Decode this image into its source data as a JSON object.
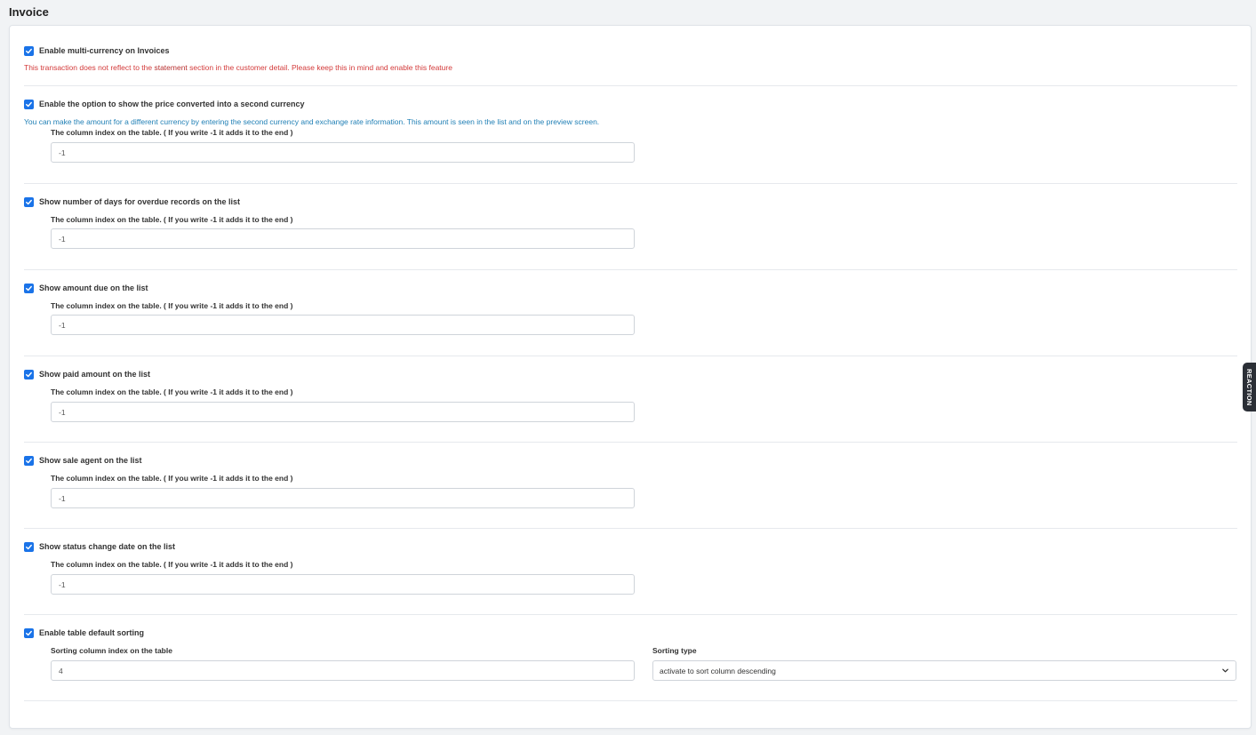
{
  "page": {
    "title": "Invoice"
  },
  "multi_currency": {
    "label": "Enable multi-currency on Invoices",
    "checked": true,
    "warning_pre": "This transaction does not reflect to the ",
    "warning_bold": "statement",
    "warning_post": " section in the customer detail. Please keep this in mind and enable this feature"
  },
  "second_currency": {
    "label": "Enable the option to show the price converted into a second currency",
    "checked": true,
    "info": "You can make the amount for a different currency by entering the second currency and exchange rate information. This amount is seen in the list and on the preview screen.",
    "column_label": "The column index on the table. ( If you write -1 it adds it to the end )",
    "column_value": "-1"
  },
  "overdue_days": {
    "label": "Show number of days for overdue records on the list",
    "checked": true,
    "column_label": "The column index on the table. ( If you write -1 it adds it to the end )",
    "column_value": "-1"
  },
  "amount_due": {
    "label": "Show amount due on the list",
    "checked": true,
    "column_label": "The column index on the table. ( If you write -1 it adds it to the end )",
    "column_value": "-1"
  },
  "paid_amount": {
    "label": "Show paid amount on the list",
    "checked": true,
    "column_label": "The column index on the table. ( If you write -1 it adds it to the end )",
    "column_value": "-1"
  },
  "sale_agent": {
    "label": "Show sale agent on the list",
    "checked": true,
    "column_label": "The column index on the table. ( If you write -1 it adds it to the end )",
    "column_value": "-1"
  },
  "status_change": {
    "label": "Show status change date on the list",
    "checked": true,
    "column_label": "The column index on the table. ( If you write -1 it adds it to the end )",
    "column_value": "-1"
  },
  "default_sorting": {
    "label": "Enable table default sorting",
    "checked": true,
    "column_label": "Sorting column index on the table",
    "column_value": "4",
    "type_label": "Sorting type",
    "type_value": "activate to sort column descending"
  },
  "side_tab": {
    "label": "REACTION"
  },
  "colors": {
    "checkbox": "#1a73e8",
    "warning": "#d33a3a",
    "info": "#1f7fb5"
  },
  "icons": {
    "checkbox": "check-icon",
    "select": "chevron-down-icon"
  }
}
